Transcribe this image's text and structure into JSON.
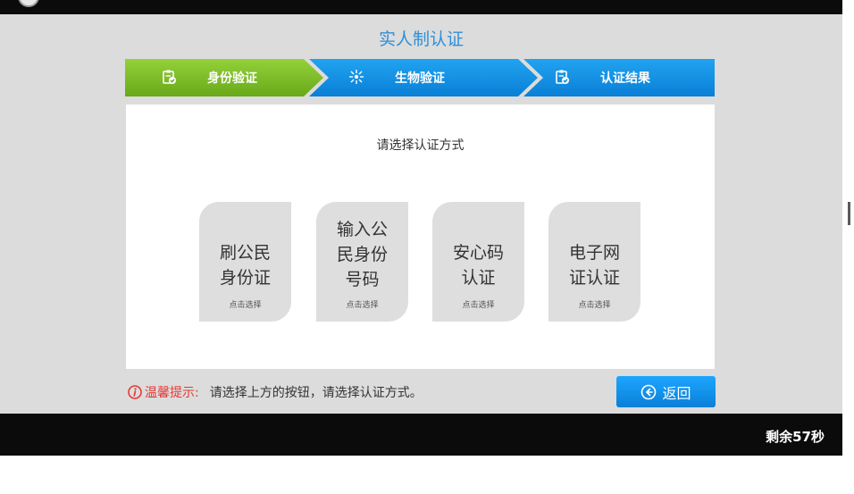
{
  "page": {
    "title": "实人制认证"
  },
  "steps": [
    {
      "label": "身份验证",
      "icon": "clipboard-check-icon",
      "state": "active"
    },
    {
      "label": "生物验证",
      "icon": "biometric-icon",
      "state": "pending"
    },
    {
      "label": "认证结果",
      "icon": "clipboard-check-icon",
      "state": "pending"
    }
  ],
  "panel": {
    "prompt": "请选择认证方式",
    "options": [
      {
        "lines": [
          "刷公民",
          "身份证"
        ],
        "hint": "点击选择"
      },
      {
        "lines": [
          "输入公",
          "民身份",
          "号码"
        ],
        "hint": "点击选择"
      },
      {
        "lines": [
          "安心码",
          "认证"
        ],
        "hint": "点击选择"
      },
      {
        "lines": [
          "电子网",
          "证认证"
        ],
        "hint": "点击选择"
      }
    ]
  },
  "tip": {
    "label": "温馨提示:",
    "text": "请选择上方的按钮，请选择认证方式。"
  },
  "back_button": {
    "label": "返回",
    "icon": "circle-arrow-left-icon"
  },
  "footer": {
    "countdown": "剩余57秒"
  },
  "colors": {
    "accent_blue": "#0a8de0",
    "step_active_green": "#7cbf24",
    "tip_red": "#e53935",
    "title_blue": "#2f8fd8"
  }
}
